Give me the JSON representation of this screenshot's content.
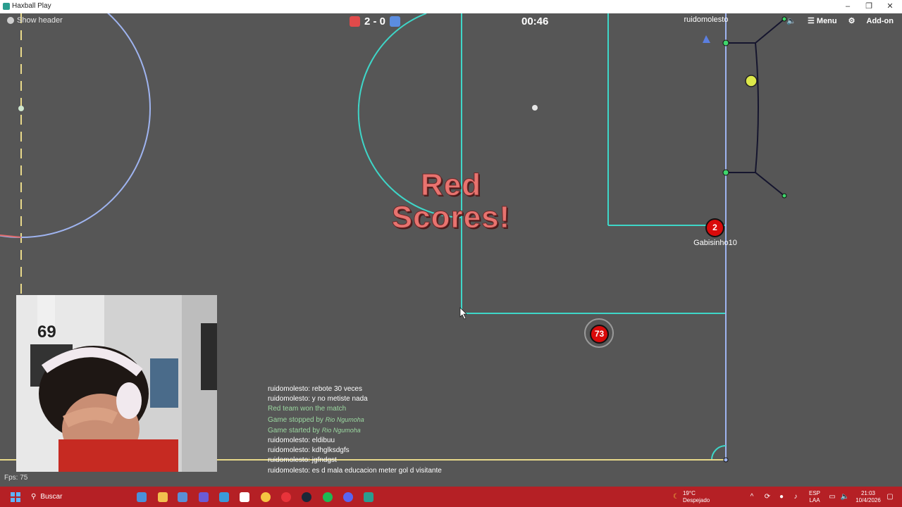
{
  "window": {
    "title": "Haxball Play",
    "minimize": "–",
    "maximize": "❐",
    "close": "✕"
  },
  "hud": {
    "show_header": "Show header",
    "score": "2 - 0",
    "timer": "00:46",
    "menu": "Menu",
    "addon": "Add-on",
    "red_color": "#e04a4a",
    "blue_color": "#5b8de0"
  },
  "goal_message": {
    "line1": "Red",
    "line2": "Scores!"
  },
  "players": [
    {
      "name": "ruidomolesto",
      "number": "",
      "team": "blue"
    },
    {
      "name": "Gabisinho10",
      "number": "2",
      "team": "red"
    },
    {
      "name": "",
      "number": "73",
      "team": "red"
    }
  ],
  "chat": [
    {
      "text": "ruidomolesto: rebote 30 veces",
      "type": "msg"
    },
    {
      "text": "ruidomolesto: y no metiste nada",
      "type": "msg"
    },
    {
      "text": "Red team won the match",
      "type": "sys"
    },
    {
      "text": "Game stopped by ",
      "who": "Rio Ngumoha",
      "type": "sys"
    },
    {
      "text": "Game started by ",
      "who": "Rio Ngumoha",
      "type": "sys"
    },
    {
      "text": "ruidomolesto: eldibuu",
      "type": "msg"
    },
    {
      "text": "ruidomolesto: kdhglksdgfs",
      "type": "msg"
    },
    {
      "text": "ruidomolesto: jgfndgst",
      "type": "msg"
    },
    {
      "text": "ruidomolesto: es d mala educacion meter gol d visitante",
      "type": "msg"
    }
  ],
  "fps": "Fps: 75",
  "webcam": {
    "jersey_number": "69"
  },
  "taskbar": {
    "search": "Buscar",
    "weather_temp": "19°C",
    "weather_desc": "Despejado",
    "lang1": "ESP",
    "lang2": "LAA",
    "time": "21:03",
    "date": "10/4/2026"
  }
}
